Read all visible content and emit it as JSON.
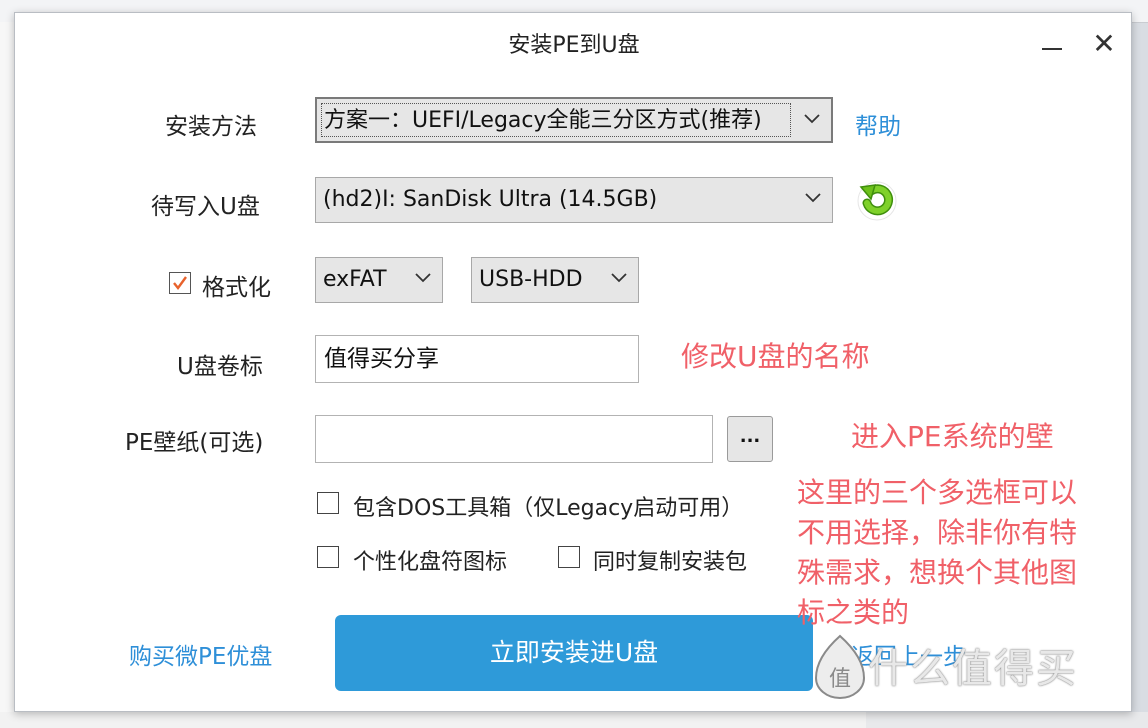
{
  "dialog": {
    "title": "安装PE到U盘",
    "install_method_label": "安装方法",
    "install_method_value": "方案一：UEFI/Legacy全能三分区方式(推荐)",
    "help_link": "帮助",
    "target_disk_label": "待写入U盘",
    "target_disk_value": "(hd2)I: SanDisk Ultra (14.5GB)",
    "format_label": "格式化",
    "format_checked": true,
    "filesystem_value": "exFAT",
    "mode_value": "USB-HDD",
    "volume_label": "U盘卷标",
    "volume_value": "值得买分享",
    "wallpaper_label": "PE壁纸(可选)",
    "wallpaper_value": "",
    "browse_label": "...",
    "option_dos": "包含DOS工具箱（仅Legacy启动可用）",
    "option_icon": "个性化盘符图标",
    "option_copy": "同时复制安装包",
    "buy_link": "购买微PE优盘",
    "install_button": "立即安装进U盘",
    "back_link": "返回上一步"
  },
  "annotations": {
    "rename": "修改U盘的名称",
    "wallpaper": "进入PE系统的壁",
    "options_line1": "这里的三个多选框可以",
    "options_line2": "不用选择，除非你有特",
    "options_line3": "殊需求，想换个其他图",
    "options_line4": "标之类的"
  },
  "watermark": {
    "logo_char": "值",
    "text": "什么值得买"
  },
  "icons": {
    "minimize": "minimize-icon",
    "close": "close-icon",
    "refresh": "refresh-icon",
    "dropdown": "chevron-down-icon",
    "check": "checkmark-icon"
  },
  "colors": {
    "link": "#2e8fd8",
    "primary_button": "#2e9ad9",
    "annotation": "#f06068",
    "refresh_green": "#6cc11a",
    "checkbox_accent": "#e8622c"
  }
}
